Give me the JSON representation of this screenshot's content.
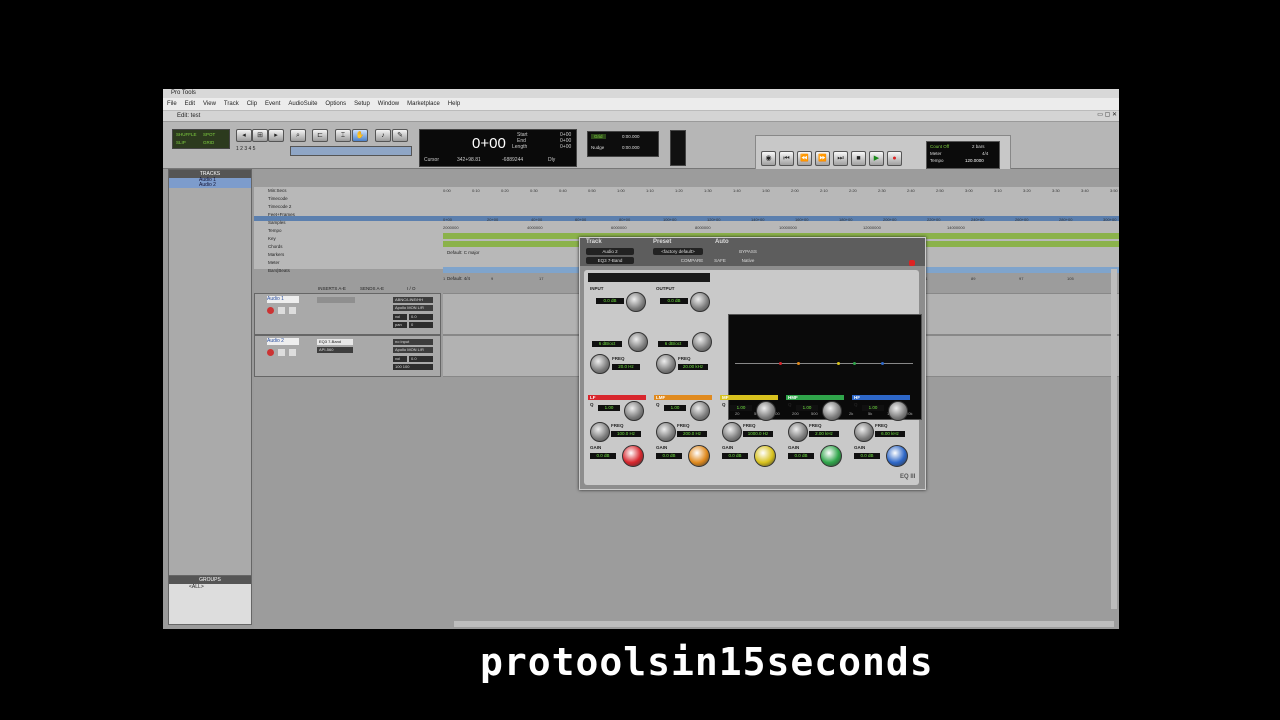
{
  "app": {
    "title": "Pro Tools",
    "edit_title": "Edit: test"
  },
  "menu": [
    "File",
    "Edit",
    "View",
    "Track",
    "Clip",
    "Event",
    "AudioSuite",
    "Options",
    "Setup",
    "Window",
    "Marketplace",
    "Help"
  ],
  "toolbar": {
    "mode_labels": [
      "SHUFFLE",
      "SPOT",
      "SLIP",
      "GRID"
    ],
    "counter_main": "0+00",
    "counter_labels": {
      "start": "Start",
      "end": "End",
      "length": "Length",
      "cursor": "Cursor",
      "nudge": "Nudge"
    },
    "counter_values": {
      "start": "0+00",
      "end": "0+00",
      "length": "0+00",
      "nudge": "0:00.000",
      "cursor": "342+98.81",
      "sample": "-6889244"
    },
    "grid_label": "Grid",
    "grid_value": "0:00.000",
    "dly": "Dly"
  },
  "transport": {
    "pre_roll": "Pre-roll",
    "post_roll": "Post-roll",
    "fade_in": "Fade-in",
    "pre_val": "0+00",
    "post_val": "0+00",
    "fade_val": "0:00.000",
    "start": "Start",
    "end": "End",
    "length": "Length",
    "count_off": "Count Off",
    "meter": "Meter",
    "tempo": "Tempo",
    "bars": "2 bars",
    "meter_val": "4/4",
    "tempo_val": "120.0000"
  },
  "tracks_panel": {
    "header": "TRACKS",
    "items": [
      "Audio 1",
      "Audio 2"
    ]
  },
  "groups_panel": {
    "header": "GROUPS",
    "items": [
      "<ALL>"
    ]
  },
  "rulers": {
    "names": [
      "Min:Secs",
      "Timecode",
      "Timecode 2",
      "Feet+Frames",
      "Samples",
      "Tempo",
      "Key",
      "Chords",
      "Markers",
      "Meter",
      "Bars|Beats"
    ],
    "minsecs": [
      "0:00",
      "0:10",
      "0:20",
      "0:30",
      "0:40",
      "0:50",
      "1:00",
      "1:10",
      "1:20",
      "1:30",
      "1:40",
      "1:50",
      "2:00",
      "2:10",
      "2:20",
      "2:30",
      "2:40",
      "2:50",
      "3:00",
      "3:10",
      "3:20",
      "3:30",
      "3:40",
      "3:50"
    ],
    "feet": [
      "0+00",
      "20+00",
      "40+00",
      "60+00",
      "80+00",
      "100+00",
      "120+00",
      "140+00",
      "160+00",
      "180+00",
      "200+00",
      "220+00",
      "240+00",
      "260+00",
      "280+00",
      "300+00"
    ],
    "samples": [
      "2000000",
      "4000000",
      "6000000",
      "8000000",
      "10000000",
      "12000000",
      "14000000"
    ],
    "tempo_marker": "♩120",
    "key_marker": "Default: C major",
    "meter_marker": "Default: 4/4",
    "bars": [
      "1",
      "9",
      "17",
      "25",
      "33",
      "41",
      "49",
      "57",
      "65",
      "73",
      "81",
      "89",
      "97",
      "105"
    ]
  },
  "mix_columns": {
    "inserts": "INSERTS A-E",
    "sends": "SENDS A-E",
    "io": "I / O"
  },
  "tracks": [
    {
      "name": "Audio 1",
      "insert": "",
      "input": "ABNC/LINE/HH",
      "output": "Apollo MON L/R",
      "vol_label": "vol",
      "vol": "0.0",
      "pan_label": "pan",
      "pan": "0"
    },
    {
      "name": "Audio 2",
      "insert": "EQ3 7-Band",
      "insert2": "API-560",
      "input": "no input",
      "output": "Apollo MON L/R",
      "vol_label": "vol",
      "vol": "0.0",
      "pan_label": "pan",
      "pan": "100  100"
    }
  ],
  "plugin": {
    "track_label": "Track",
    "preset_label": "Preset",
    "auto_label": "Auto",
    "track_name": "Audio 2",
    "preset_name": "<factory default>",
    "plugin_name": "EQ3 7-Band",
    "compare": "COMPARE",
    "safe": "SAFE",
    "bypass": "BYPASS",
    "native": "Native",
    "input_label": "INPUT",
    "output_label": "OUTPUT",
    "input_val": "0.0 dB",
    "output_val": "0.0 dB",
    "hpf_q": "6 dB/oct",
    "lpf_q": "6 dB/oct",
    "hpf_freq": "20.0 Hz",
    "lpf_freq": "20.00 kHz",
    "freq_label": "FREQ",
    "gain_label": "GAIN",
    "q_label": "Q",
    "bands": [
      {
        "name": "LF",
        "q": "1.00",
        "freq": "100.0 Hz",
        "gain": "0.0 dB",
        "color": "#d8262d"
      },
      {
        "name": "LMF",
        "q": "1.00",
        "freq": "200.0 Hz",
        "gain": "0.0 dB",
        "color": "#e08a1e"
      },
      {
        "name": "MF",
        "q": "1.00",
        "freq": "1000.0 Hz",
        "gain": "0.0 dB",
        "color": "#d8c21e"
      },
      {
        "name": "HMF",
        "q": "1.00",
        "freq": "2.00 kHz",
        "gain": "0.0 dB",
        "color": "#2fa54a"
      },
      {
        "name": "HF",
        "q": "1.00",
        "freq": "6.00 kHz",
        "gain": "0.0 dB",
        "color": "#2d67c8"
      }
    ],
    "graph_scale": [
      "20",
      "50",
      "100",
      "200",
      "500",
      "1k",
      "2k",
      "5k",
      "10k",
      "20k"
    ],
    "logo": "EQ III"
  },
  "banner": "protoolsin15seconds"
}
